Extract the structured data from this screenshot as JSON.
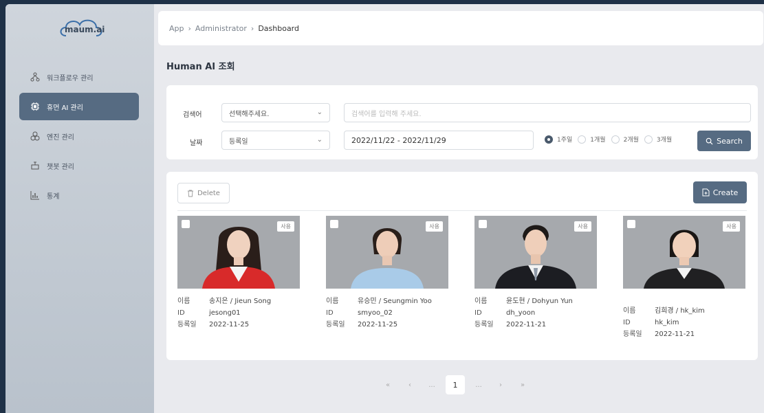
{
  "brand": {
    "logo_text": "maum.ai"
  },
  "sidebar": {
    "items": [
      {
        "label": "워크플로우 관리",
        "icon": "workflow-icon"
      },
      {
        "label": "휴먼 AI 관리",
        "icon": "chip-icon",
        "active": true
      },
      {
        "label": "엔진 관리",
        "icon": "engine-icon"
      },
      {
        "label": "챗봇 관리",
        "icon": "chatbot-icon"
      },
      {
        "label": "통계",
        "icon": "chart-icon"
      }
    ]
  },
  "breadcrumb": {
    "items": [
      "App",
      "Administrator",
      "Dashboard"
    ],
    "separator": "›"
  },
  "page": {
    "title": "Human AI 조회"
  },
  "search": {
    "keyword_label": "검색어",
    "keyword_select": "선택해주세요.",
    "keyword_placeholder": "검색어를 입력해 주세요.",
    "date_label": "날짜",
    "date_select": "등록일",
    "date_range": "2022/11/22 - 2022/11/29",
    "periods": [
      "1주일",
      "1개월",
      "2개월",
      "3개월"
    ],
    "selected_period": "1주일",
    "search_button": "Search"
  },
  "list": {
    "delete_button": "Delete",
    "create_button": "Create",
    "field_labels": {
      "name": "이름",
      "id": "ID",
      "date": "등록일"
    },
    "cards": [
      {
        "badge": "사용",
        "name": "송지은 / Jieun Song",
        "id": "jesong01",
        "date": "2022-11-25"
      },
      {
        "badge": "사용",
        "name": "유승민 / Seungmin Yoo",
        "id": "smyoo_02",
        "date": "2022-11-25"
      },
      {
        "badge": "사용",
        "name": "윤도현 / Dohyun Yun",
        "id": "dh_yoon",
        "date": "2022-11-21"
      },
      {
        "badge": "사용",
        "name": "김희경 / hk_kim",
        "id": "hk_kim",
        "date": "2022-11-21"
      }
    ]
  },
  "pagination": {
    "first": "«",
    "prev": "‹",
    "ellipsis": "...",
    "current": "1",
    "next": "›",
    "last": "»"
  },
  "colors": {
    "accent": "#566b82",
    "sidebar": "#c4ccd5",
    "background": "#e9eaee"
  }
}
